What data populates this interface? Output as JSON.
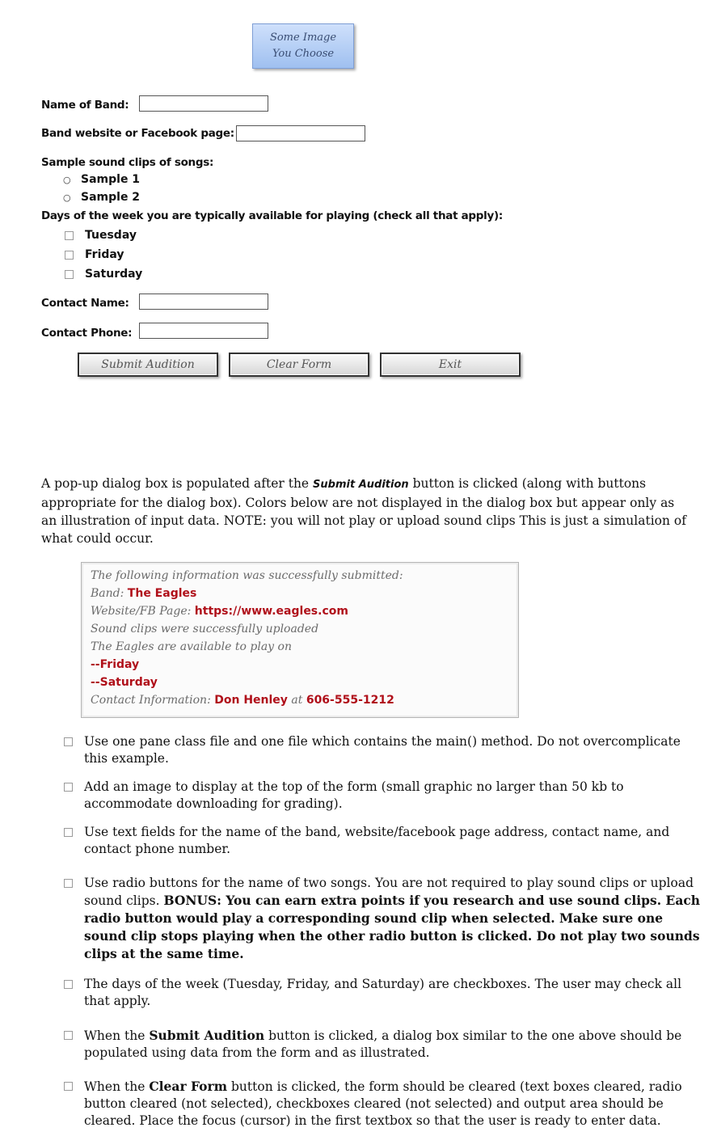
{
  "image_placeholder": {
    "line1": "Some Image",
    "line2": "You Choose"
  },
  "form": {
    "band_name_label": "Name of Band:",
    "band_name_value": "",
    "website_label": "Band website or Facebook page:",
    "website_value": "",
    "sound_clips_label": "Sample sound clips of songs:",
    "radio_options": [
      "Sample 1",
      "Sample 2"
    ],
    "days_label": "Days of the week you are typically available for playing (check all that apply):",
    "day_options": [
      "Tuesday",
      "Friday",
      "Saturday"
    ],
    "contact_name_label": "Contact Name:",
    "contact_name_value": "",
    "contact_phone_label": "Contact Phone:",
    "contact_phone_value": "",
    "buttons": {
      "submit": "Submit Audition",
      "clear": "Clear Form",
      "exit": "Exit"
    }
  },
  "description": {
    "part1": "A pop-up dialog box is populated after the ",
    "emphasis": "Submit Audition",
    "part2": " button is clicked (along with buttons appropriate for the dialog box).  Colors below are not displayed in the dialog box but appear only as an illustration of input data.  NOTE:  you will not play or upload sound clips  This is just a simulation of what could occur."
  },
  "dialog": {
    "header": "The following information was successfully submitted:",
    "band_label": "Band:",
    "band_value": "The Eagles",
    "website_label": "Website/FB Page:",
    "website_value": "https://www.eagles.com",
    "sound_status": "Sound clips were successfully uploaded",
    "available_text": "The Eagles are available to play on",
    "days": [
      "--Friday",
      "--Saturday"
    ],
    "contact_label": "Contact Information:",
    "contact_name": "Don Henley",
    "contact_at": "at",
    "contact_phone": "606-555-1212",
    "highlight_color": "#b0101a"
  },
  "requirements": [
    {
      "text": "Use one pane class file and one file which contains the main() method.  Do not overcomplicate this example."
    },
    {
      "text": "Add an image to display at the top of the form (small graphic no larger than 50 kb to accommodate downloading for grading)."
    },
    {
      "text": "Use text fields for the name of the band, website/facebook page address, contact name, and contact phone number."
    },
    {
      "pre": "Use radio buttons for the name of two songs.  You are not required to play sound clips or upload sound clips. ",
      "bold": "BONUS:  You can earn extra points if you research and use sound clips.  Each radio button would play a corresponding sound clip when selected.  Make sure one sound clip stops playing when the other radio button is clicked.  Do not play two sounds clips at the same time.",
      "post": ""
    },
    {
      "text": "The days of the week (Tuesday, Friday, and Saturday) are checkboxes.  The user may check all that apply."
    },
    {
      "pre": "When the ",
      "bold": "Submit Audition",
      "post": " button is clicked, a dialog box similar to the one above should be populated using data from the form and as illustrated."
    },
    {
      "pre": "When the ",
      "bold": "Clear Form",
      "post": " button is clicked, the form should be cleared (text boxes cleared, radio button cleared (not selected), checkboxes cleared (not selected) and output area should be cleared. Place the focus (cursor) in the first textbox so that the user is ready to enter data."
    }
  ]
}
